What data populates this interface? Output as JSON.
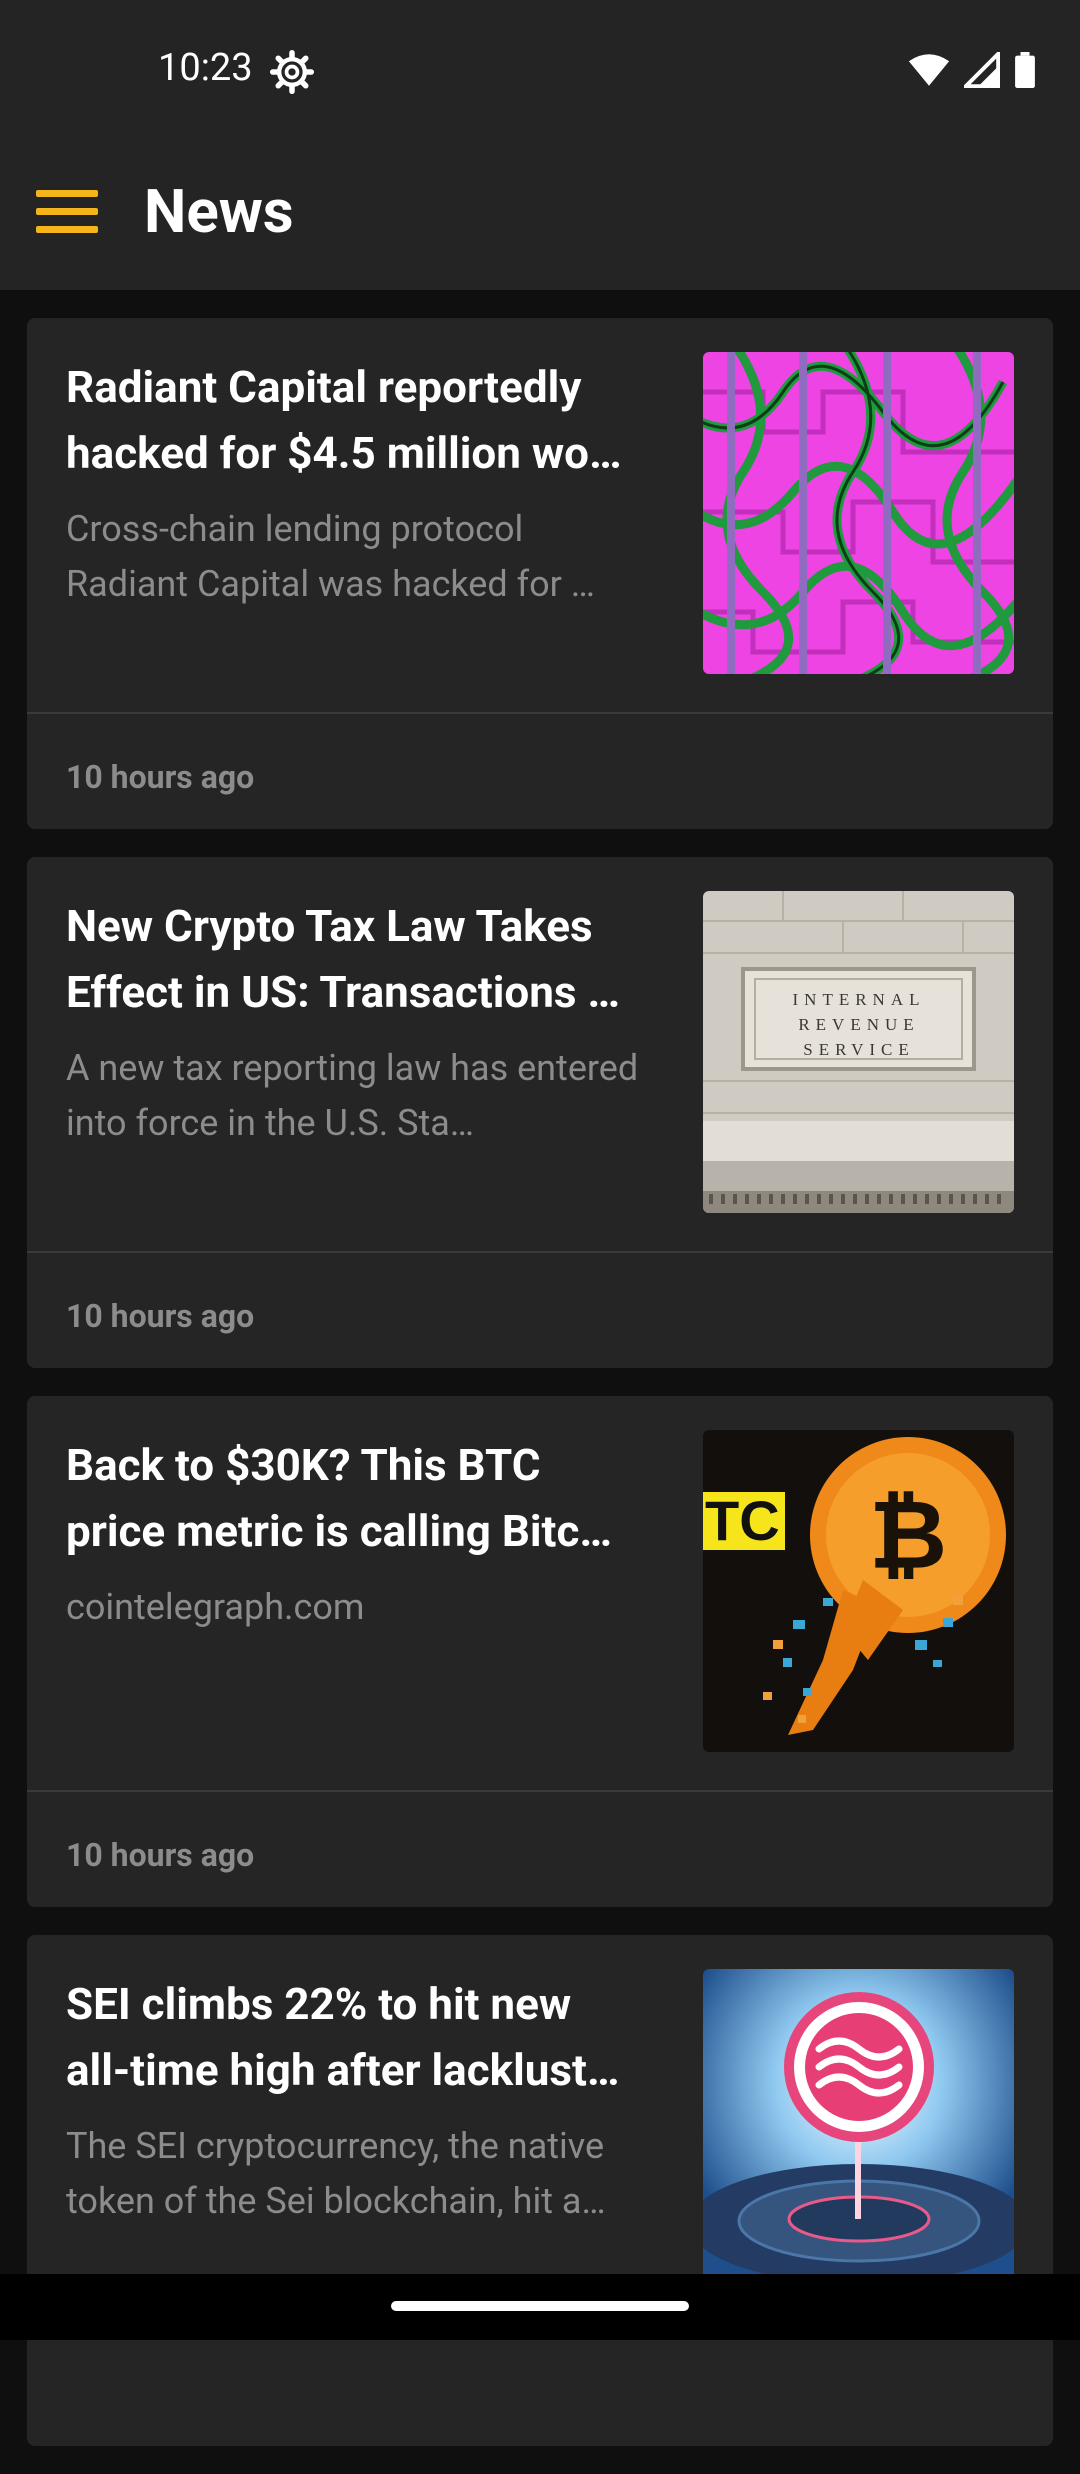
{
  "status_bar": {
    "time": "10:23"
  },
  "app_bar": {
    "title": "News"
  },
  "articles": [
    {
      "title": "Radiant Capital reportedly hacked for $4.5 million wo…",
      "summary": "Cross-chain lending protocol Radiant Capital was hacked for …",
      "time": "10 hours ago"
    },
    {
      "title": "New Crypto Tax Law Takes Effect in US: Transactions …",
      "summary": "A new tax reporting law has entered into force in the U.S. Sta…",
      "time": "10 hours ago",
      "image_text": [
        "INTERNAL",
        "REVENUE",
        "SERVICE"
      ]
    },
    {
      "title": "Back to $30K? This BTC price metric is calling Bitc…",
      "summary": "cointelegraph.com",
      "time": "10 hours ago",
      "image_text": "TC"
    },
    {
      "title": "SEI climbs 22% to hit new all-time high after lacklust…",
      "summary": "The SEI cryptocurrency, the native token of the Sei blockchain, hit a…"
    }
  ],
  "colors": {
    "accent": "#f3b519",
    "card": "#252525",
    "background": "#0f0f0f",
    "bar": "#242424"
  }
}
